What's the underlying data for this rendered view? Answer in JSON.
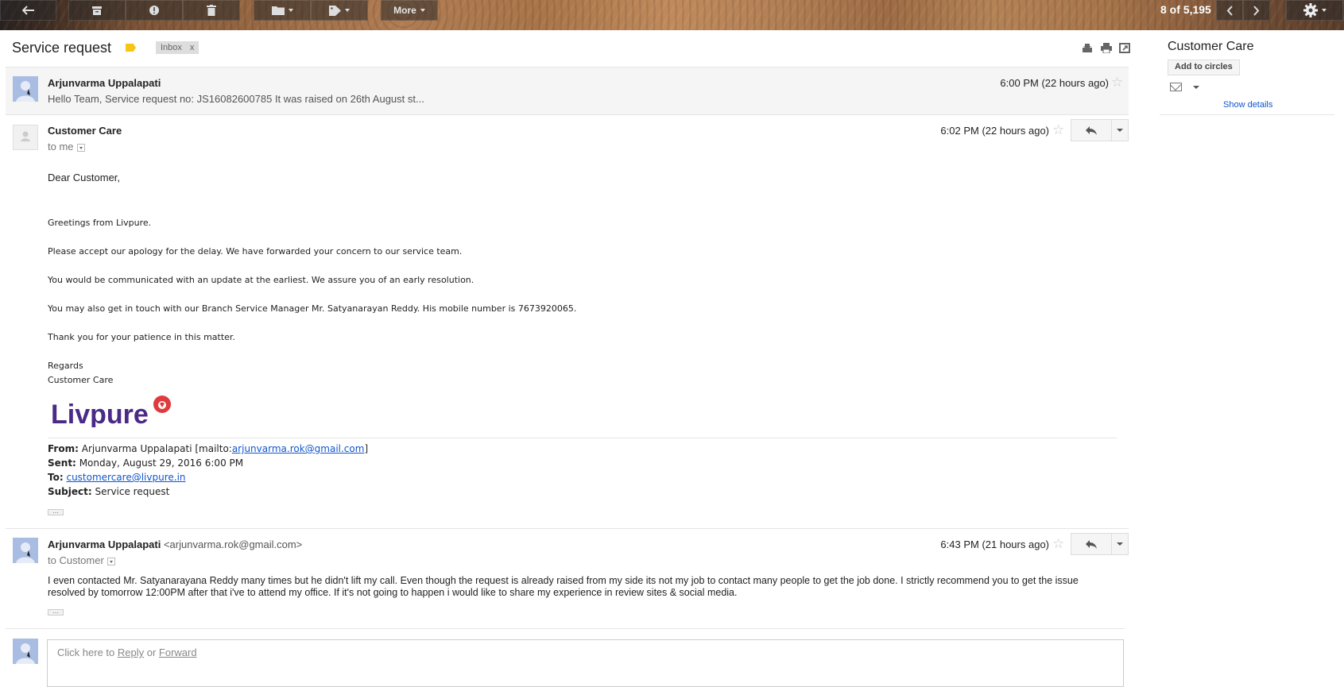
{
  "toolbar": {
    "more_label": "More",
    "pager": "8 of 5,195"
  },
  "thread": {
    "subject": "Service request",
    "label_chip": "Inbox",
    "label_chip_close": "x"
  },
  "messages": [
    {
      "sender": "Arjunvarma Uppalapati",
      "snippet": "Hello Team, Service request no: JS16082600785 It was raised on 26th August st...",
      "time": "6:00 PM (22 hours ago)"
    },
    {
      "sender": "Customer Care",
      "recipient": "to me",
      "time": "6:02 PM (22 hours ago)",
      "greeting": "Dear Customer,",
      "lines": [
        "Greetings from Livpure.",
        "Please accept our apology for the delay. We have forwarded your concern to our service team.",
        "You would be communicated with an update at the earliest. We assure you of an early resolution.",
        "You may also get in touch with our Branch Service Manager Mr. Satyanarayan Reddy. His mobile number is 7673920065.",
        "Thank you for your patience in this matter.",
        "Regards",
        "Customer Care"
      ],
      "logo_text": "Livpure",
      "forwarded": {
        "from_label": "From:",
        "from_name": "Arjunvarma Uppalapati [mailto:",
        "from_email": "arjunvarma.rok@gmail.com",
        "from_close": "]",
        "sent_label": "Sent:",
        "sent_value": "Monday, August 29, 2016 6:00 PM",
        "to_label": "To:",
        "to_email": "customercare@livpure.in",
        "subject_label": "Subject:",
        "subject_value": "Service request"
      }
    },
    {
      "sender": "Arjunvarma Uppalapati",
      "sender_email": "<arjunvarma.rok@gmail.com>",
      "recipient": "to Customer",
      "time": "6:43 PM (21 hours ago)",
      "body": "I even contacted Mr. Satyanarayana Reddy many times but he didn't lift my call. Even though the request is already raised from my side its not my job to contact many people to get the job done. I strictly recommend you to get the issue resolved by tomorrow 12:00PM after that i've to attend my office. If it's not going to happen i would like to share my experience in review sites & social media."
    }
  ],
  "reply": {
    "prefix": "Click here to ",
    "reply_link": "Reply",
    "or": " or ",
    "forward_link": "Forward"
  },
  "sidebar": {
    "contact_name": "Customer Care",
    "add_circles": "Add to circles",
    "show_details": "Show details"
  },
  "colors": {
    "label_yellow": "#f5c518",
    "link_blue": "#1155cc",
    "livpure_purple": "#4b2a86",
    "livpure_red": "#e03a3e"
  }
}
